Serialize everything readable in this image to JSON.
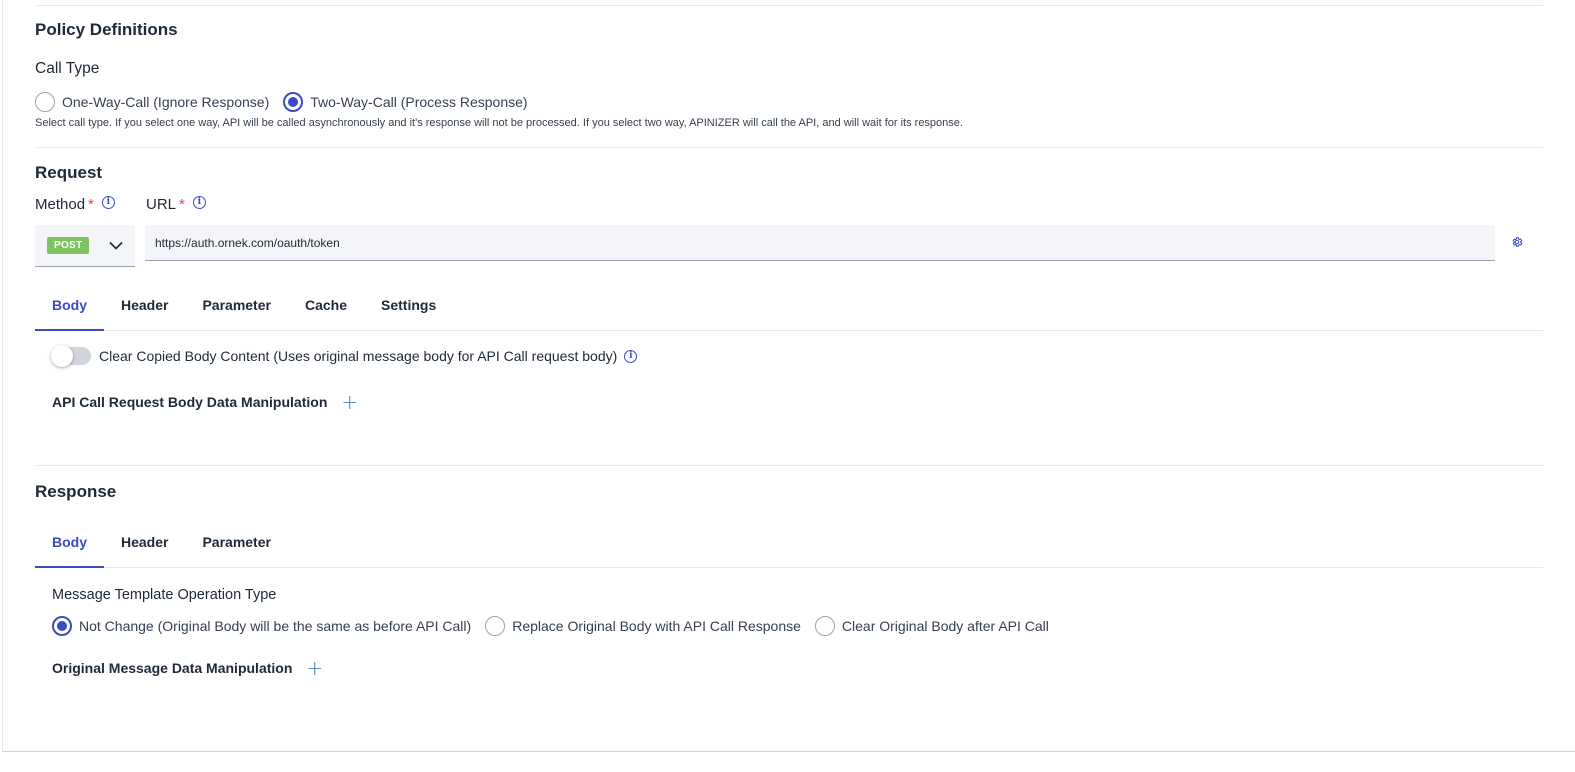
{
  "policy": {
    "title": "Policy Definitions",
    "call_type_label": "Call Type",
    "call_type_options": [
      {
        "label": "One-Way-Call (Ignore Response)",
        "checked": false
      },
      {
        "label": "Two-Way-Call (Process Response)",
        "checked": true
      }
    ],
    "call_type_hint": "Select call type. If you select one way, API will be called asynchronously and it's response will not be processed. If you select two way, APINIZER will call the API, and will wait for its response."
  },
  "request": {
    "title": "Request",
    "method_label": "Method",
    "url_label": "URL",
    "required_mark": "*",
    "method_value": "POST",
    "url_value": "https://auth.ornek.com/oauth/token",
    "tabs": [
      "Body",
      "Header",
      "Parameter",
      "Cache",
      "Settings"
    ],
    "active_tab": "Body",
    "clear_body_label": "Clear Copied Body Content (Uses original message body for API Call request body)",
    "clear_body_enabled": false,
    "body_manipulation_label": "API Call Request Body Data Manipulation"
  },
  "response": {
    "title": "Response",
    "tabs": [
      "Body",
      "Header",
      "Parameter"
    ],
    "active_tab": "Body",
    "operation_type_label": "Message Template Operation Type",
    "operation_options": [
      {
        "label": "Not Change (Original Body will be the same as before API Call)",
        "checked": true
      },
      {
        "label": "Replace Original Body with API Call Response",
        "checked": false
      },
      {
        "label": "Clear Original Body after API Call",
        "checked": false
      }
    ],
    "original_manipulation_label": "Original Message Data Manipulation"
  },
  "icons": {
    "info": "info-icon",
    "gear": "gear-icon",
    "plus": "plus-icon",
    "chevron": "chevron-down-icon"
  },
  "colors": {
    "accent": "#3b4cc0",
    "post_badge": "#7cc45f",
    "required": "#ef4444"
  }
}
